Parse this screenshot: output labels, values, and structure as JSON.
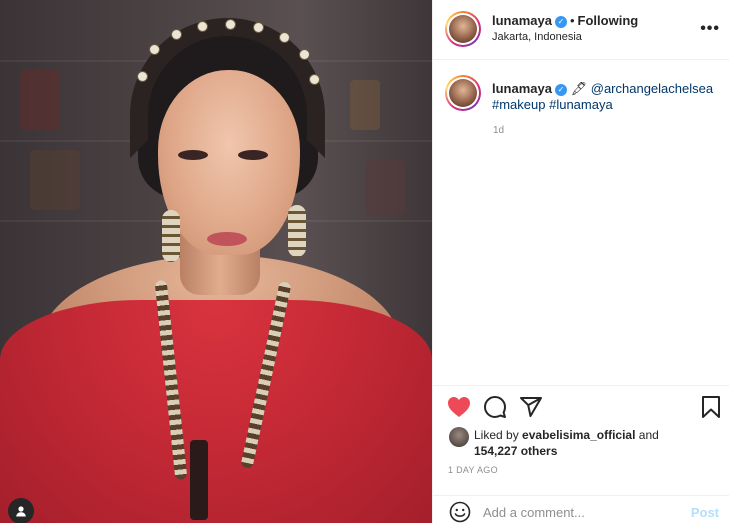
{
  "post": {
    "author": {
      "username": "lunamaya",
      "verified": true,
      "follow_state": "Following",
      "location": "Jakarta, Indonesia"
    },
    "more_options_icon": "more-horizontal-icon",
    "caption": {
      "username": "lunamaya",
      "emoji": "🖋",
      "mention": "@archangelachelsea",
      "hashtags": "#makeup #lunamaya",
      "time": "1d"
    },
    "actions": {
      "like_icon": "heart-filled-icon",
      "comment_icon": "comment-icon",
      "share_icon": "share-icon",
      "save_icon": "bookmark-icon"
    },
    "likes": {
      "prefix": "Liked by",
      "liker": "evabelisima_official",
      "conjunction": "and",
      "others": "154,227 others"
    },
    "posted_ago": "1 DAY AGO",
    "comment": {
      "placeholder": "Add a comment...",
      "post_label": "Post",
      "emoji_icon": "smiley-icon"
    }
  },
  "photo": {
    "tag_icon": "user-tag-icon"
  },
  "colors": {
    "like_red": "#ed4956",
    "link_blue": "#00376b",
    "verified_blue": "#3897f0",
    "post_disabled": "#b2dffc"
  }
}
